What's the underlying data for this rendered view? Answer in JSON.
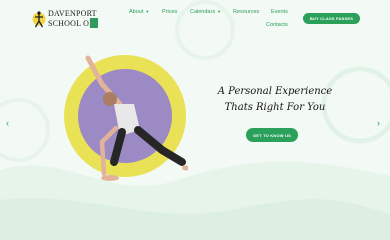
{
  "logo": {
    "line1": "DAVENPORT",
    "line2": "SCHOOL OF"
  },
  "nav": {
    "about": "About",
    "prices": "Prices",
    "calendars": "Calendars",
    "resources": "Resources",
    "events": "Events",
    "contacts": "Contacts"
  },
  "cta_label": "BUY CLASS PASSES",
  "hero": {
    "line1": "A Personal Experience",
    "line2": "Thats Right For You",
    "button_label": "GET TO KNOW US"
  },
  "carousel": {
    "prev_icon": "chevron-left-icon",
    "next_icon": "chevron-right-icon"
  },
  "colors": {
    "accent": "#2aa05a",
    "ring": "#e9e156",
    "disc": "#9b8ac4",
    "background": "#f3faf5"
  }
}
